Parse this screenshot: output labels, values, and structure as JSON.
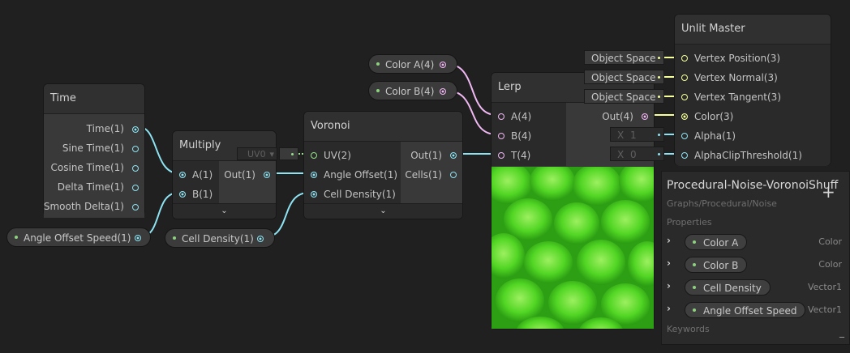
{
  "nodes": {
    "time": {
      "title": "Time",
      "outputs": [
        "Time(1)",
        "Sine Time(1)",
        "Cosine Time(1)",
        "Delta Time(1)",
        "Smooth Delta(1)"
      ]
    },
    "multiply": {
      "title": "Multiply",
      "inputs": [
        "A(1)",
        "B(1)"
      ],
      "outputs": [
        "Out(1)"
      ]
    },
    "voronoi": {
      "title": "Voronoi",
      "inputs": [
        "UV(2)",
        "Angle Offset(1)",
        "Cell Density(1)"
      ],
      "outputs": [
        "Out(1)",
        "Cells(1)"
      ],
      "uv_default": "UV0"
    },
    "lerp": {
      "title": "Lerp",
      "inputs": [
        "A(4)",
        "B(4)",
        "T(4)"
      ],
      "outputs": [
        "Out(4)"
      ]
    },
    "unlit_master": {
      "title": "Unlit Master",
      "inputs": [
        "Vertex Position(3)",
        "Vertex Normal(3)",
        "Vertex Tangent(3)",
        "Color(3)",
        "Alpha(1)",
        "AlphaClipThreshold(1)"
      ]
    }
  },
  "properties_nodes": {
    "color_a": "Color A(4)",
    "color_b": "Color B(4)",
    "angle_offset_speed": "Angle Offset Speed(1)",
    "cell_density": "Cell Density(1)"
  },
  "master_fields": {
    "vertex_position": "Object Space",
    "vertex_normal": "Object Space",
    "vertex_tangent": "Object Space",
    "alpha_x": "X",
    "alpha_value": "1",
    "clip_x": "X",
    "clip_value": "0"
  },
  "blackboard": {
    "title": "Procedural-Noise-VoronoiShuff",
    "subtitle": "Graphs/Procedural/Noise",
    "add_icon": "+",
    "properties_label": "Properties",
    "keywords_label": "Keywords",
    "properties": [
      {
        "name": "Color A",
        "type": "Color"
      },
      {
        "name": "Color B",
        "type": "Color"
      },
      {
        "name": "Cell Density",
        "type": "Vector1"
      },
      {
        "name": "Angle Offset Speed",
        "type": "Vector1"
      }
    ]
  },
  "colors": {
    "background": "#202020",
    "float_port": "#8ee3f2",
    "vector2_port": "#97e08c",
    "vector3_port": "#f6ff9a",
    "vector4_port": "#f1b9f4",
    "preview_green": "#3cc91f"
  }
}
